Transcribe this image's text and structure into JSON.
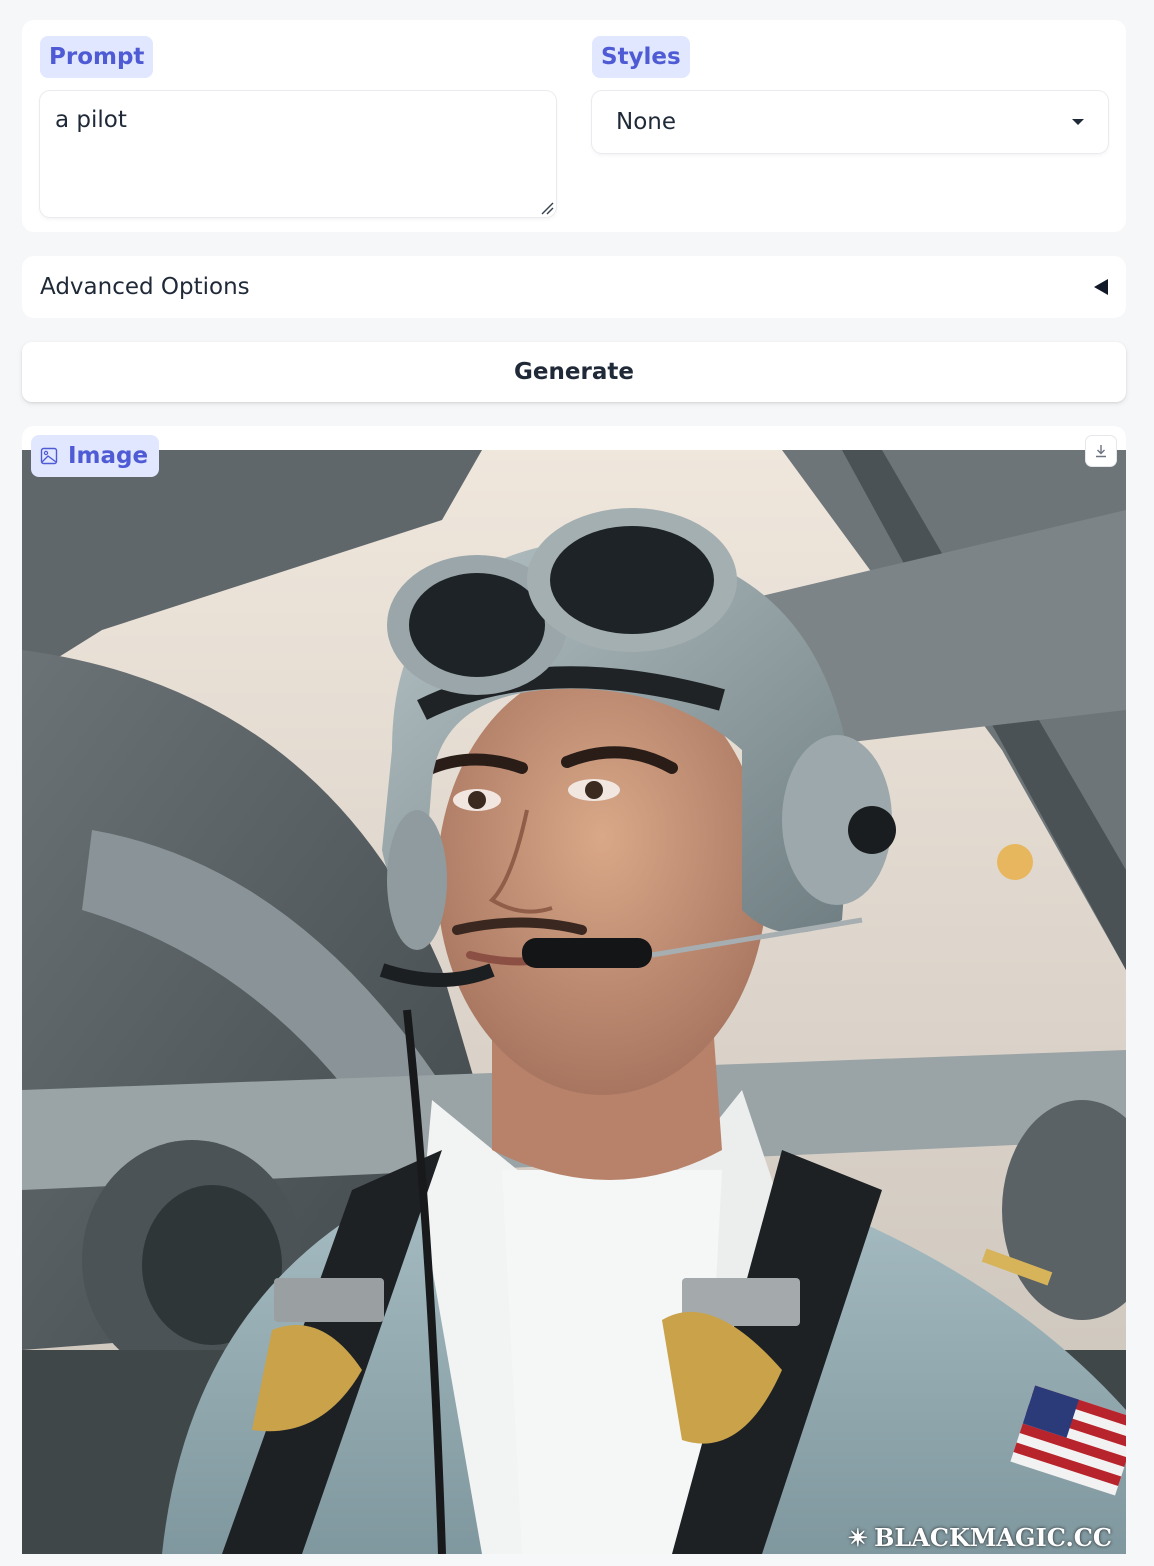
{
  "prompt": {
    "label": "Prompt",
    "value": "a pilot"
  },
  "styles": {
    "label": "Styles",
    "selected": "None"
  },
  "advanced": {
    "label": "Advanced Options",
    "icon": "caret-left-icon"
  },
  "generate": {
    "label": "Generate"
  },
  "output": {
    "label": "Image",
    "label_icon": "image-icon",
    "download_icon": "download-icon",
    "watermark": "BLACKMAGIC.CC"
  },
  "colors": {
    "accent": "#4f5bd5",
    "chip_bg": "#e0e7ff",
    "page_bg": "#f6f7f9"
  }
}
